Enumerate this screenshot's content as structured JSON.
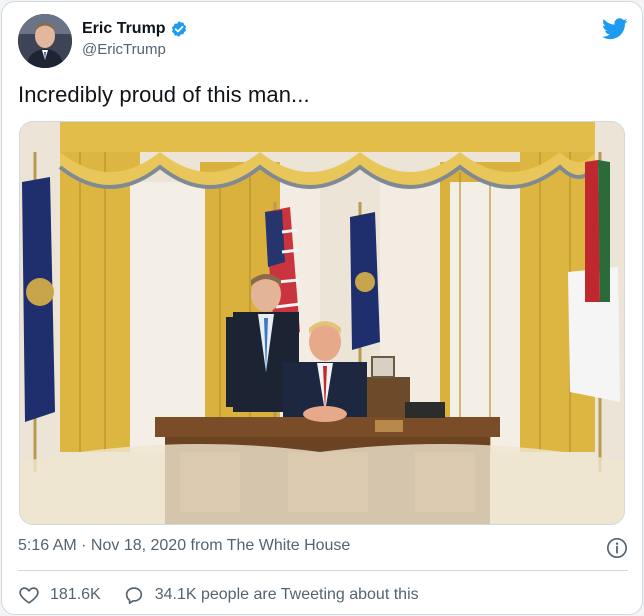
{
  "author": {
    "display_name": "Eric Trump",
    "handle": "@EricTrump",
    "verified": true,
    "avatar_icon": "avatar-portrait"
  },
  "brand": {
    "icon": "twitter-bird-icon",
    "color": "#1d9bf0"
  },
  "tweet": {
    "text": "Incredibly proud of this man..."
  },
  "media": {
    "kind": "photo",
    "icon": "oval-office-photo"
  },
  "meta": {
    "timestamp": "5:16 AM · Nov 18, 2020 from The White House"
  },
  "actions": {
    "likes": "181.6K",
    "conversation": "34.1K people are Tweeting about this"
  },
  "colors": {
    "text_primary": "#0f1419",
    "text_secondary": "#536471",
    "border": "#cfd9de",
    "verified": "#1d9bf0"
  }
}
